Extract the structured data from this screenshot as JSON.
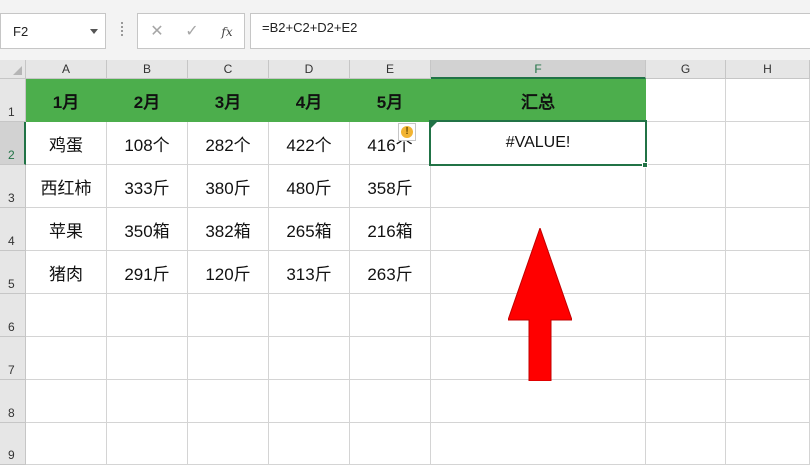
{
  "formula_bar": {
    "name_box": "F2",
    "cancel_icon": "close-icon",
    "enter_icon": "check-icon",
    "fx_label": "fx",
    "formula": "=B2+C2+D2+E2"
  },
  "columns": [
    "A",
    "B",
    "C",
    "D",
    "E",
    "F",
    "G",
    "H"
  ],
  "rows": [
    "1",
    "2",
    "3",
    "4",
    "5",
    "6",
    "7",
    "8",
    "9"
  ],
  "table": {
    "header": [
      "1月",
      "2月",
      "3月",
      "4月",
      "5月",
      "汇总"
    ],
    "rows": [
      [
        "鸡蛋",
        "108个",
        "282个",
        "422个",
        "416个",
        "#VALUE!"
      ],
      [
        "西红柿",
        "333斤",
        "380斤",
        "480斤",
        "358斤",
        ""
      ],
      [
        "苹果",
        "350箱",
        "382箱",
        "265箱",
        "216箱",
        ""
      ],
      [
        "猪肉",
        "291斤",
        "120斤",
        "313斤",
        "263斤",
        ""
      ]
    ]
  },
  "selected_cell": "F2",
  "warning_icon": "exclamation-icon",
  "colors": {
    "header_fill": "#4cae4c",
    "selection": "#217346",
    "arrow": "#ff0000"
  }
}
